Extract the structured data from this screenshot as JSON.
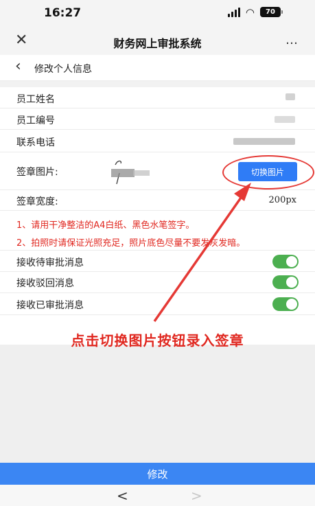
{
  "status": {
    "time": "16:27",
    "battery": "70",
    "wifi_icon": "wifi-icon",
    "signal_icon": "signal-icon"
  },
  "app": {
    "title": "财务网上审批系统",
    "close_icon": "close-icon",
    "more_icon": "more-icon"
  },
  "page": {
    "back_icon": "back-icon",
    "title": "修改个人信息"
  },
  "info": {
    "name_label": "员工姓名",
    "id_label": "员工编号",
    "phone_label": "联系电话",
    "signature_label": "签章图片:",
    "signature_button": "切换图片",
    "width_label": "签章宽度:",
    "width_value": "200px"
  },
  "notes": [
    "1、请用干净整洁的A4白纸、黑色水笔签字。",
    "2、拍照时请保证光照充足，照片底色尽量不要发灰发暗。"
  ],
  "settings": [
    {
      "label": "接收待审批消息",
      "enabled": true
    },
    {
      "label": "接收驳回消息",
      "enabled": true
    },
    {
      "label": "接收已审批消息",
      "enabled": true
    }
  ],
  "annotation": "点击切换图片按钮录入签章",
  "submit_label": "修改",
  "browser_nav": {
    "back": "<",
    "forward": ">"
  },
  "colors": {
    "accent": "#2f7cf6",
    "submit": "#3b86f3",
    "toggle_on": "#4caf50",
    "warning": "#e0271f"
  }
}
